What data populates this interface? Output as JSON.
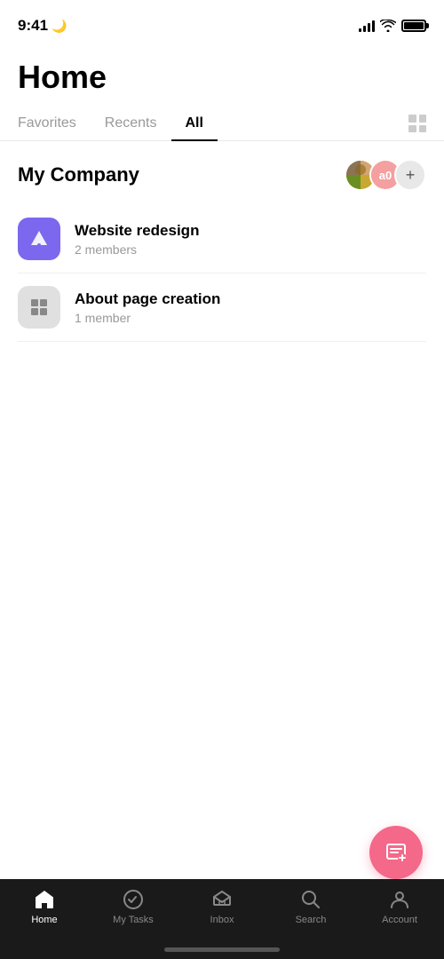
{
  "statusBar": {
    "time": "9:41",
    "moonIcon": "🌙"
  },
  "pageTitle": "Home",
  "tabs": [
    {
      "label": "Favorites",
      "active": false
    },
    {
      "label": "Recents",
      "active": false
    },
    {
      "label": "All",
      "active": true
    }
  ],
  "section": {
    "title": "My Company",
    "avatars": [
      {
        "type": "image",
        "label": "user-avatar-1"
      },
      {
        "type": "letter",
        "letter": "a0"
      },
      {
        "type": "add",
        "label": "+"
      }
    ]
  },
  "projects": [
    {
      "name": "Website redesign",
      "members": "2 members",
      "iconType": "purple"
    },
    {
      "name": "About page creation",
      "members": "1 member",
      "iconType": "gray"
    }
  ],
  "tabBar": {
    "items": [
      {
        "label": "Home",
        "active": true
      },
      {
        "label": "My Tasks",
        "active": false
      },
      {
        "label": "Inbox",
        "active": false
      },
      {
        "label": "Search",
        "active": false
      },
      {
        "label": "Account",
        "active": false
      }
    ]
  }
}
